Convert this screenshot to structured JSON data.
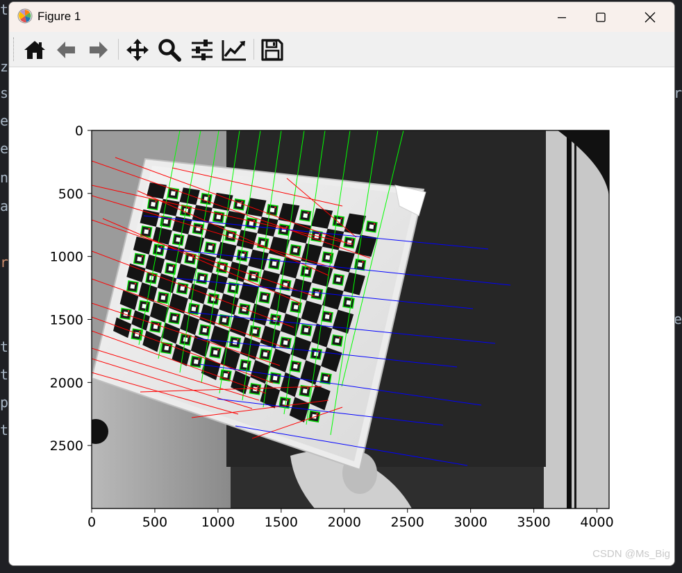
{
  "window": {
    "title": "Figure 1"
  },
  "titlebar_buttons": [
    "minimize",
    "maximize",
    "close"
  ],
  "toolbar": {
    "buttons": [
      {
        "icon": "home-icon",
        "tooltip": "Reset original view"
      },
      {
        "icon": "back-arrow-icon",
        "tooltip": "Back to previous view"
      },
      {
        "icon": "forward-arrow-icon",
        "tooltip": "Forward to next view"
      },
      {
        "icon": "pan-move-icon",
        "tooltip": "Pan axes"
      },
      {
        "icon": "zoom-magnifier-icon",
        "tooltip": "Zoom to rectangle"
      },
      {
        "icon": "configure-subplots-icon",
        "tooltip": "Configure subplots"
      },
      {
        "icon": "edit-axes-icon",
        "tooltip": "Edit axis"
      },
      {
        "icon": "save-floppy-icon",
        "tooltip": "Save the figure"
      }
    ]
  },
  "plot": {
    "x_ticks": [
      "0",
      "500",
      "1000",
      "1500",
      "2000",
      "2500",
      "3000",
      "3500",
      "4000"
    ],
    "y_ticks": [
      "0",
      "500",
      "1000",
      "1500",
      "2000",
      "2500"
    ],
    "x_tick_values": [
      0,
      500,
      1000,
      1500,
      2000,
      2500,
      3000,
      3500,
      4000
    ],
    "y_tick_values": [
      0,
      500,
      1000,
      1500,
      2000,
      2500
    ],
    "x_range": [
      0,
      4096
    ],
    "y_range": [
      3000,
      0
    ],
    "image_description": "grayscale photo of ChArUco calibration board with reprojection lines",
    "line_colors": {
      "red": "#ff0000",
      "green": "#00ff00",
      "blue": "#0000ff"
    }
  },
  "background_editor": {
    "left_chars": [
      "t",
      "z",
      "s",
      "e",
      "e",
      "n",
      "a",
      "r",
      "t",
      "t",
      "p",
      "t"
    ],
    "right_chars": [
      "r",
      "e"
    ]
  },
  "watermark": "CSDN @Ms_Big"
}
